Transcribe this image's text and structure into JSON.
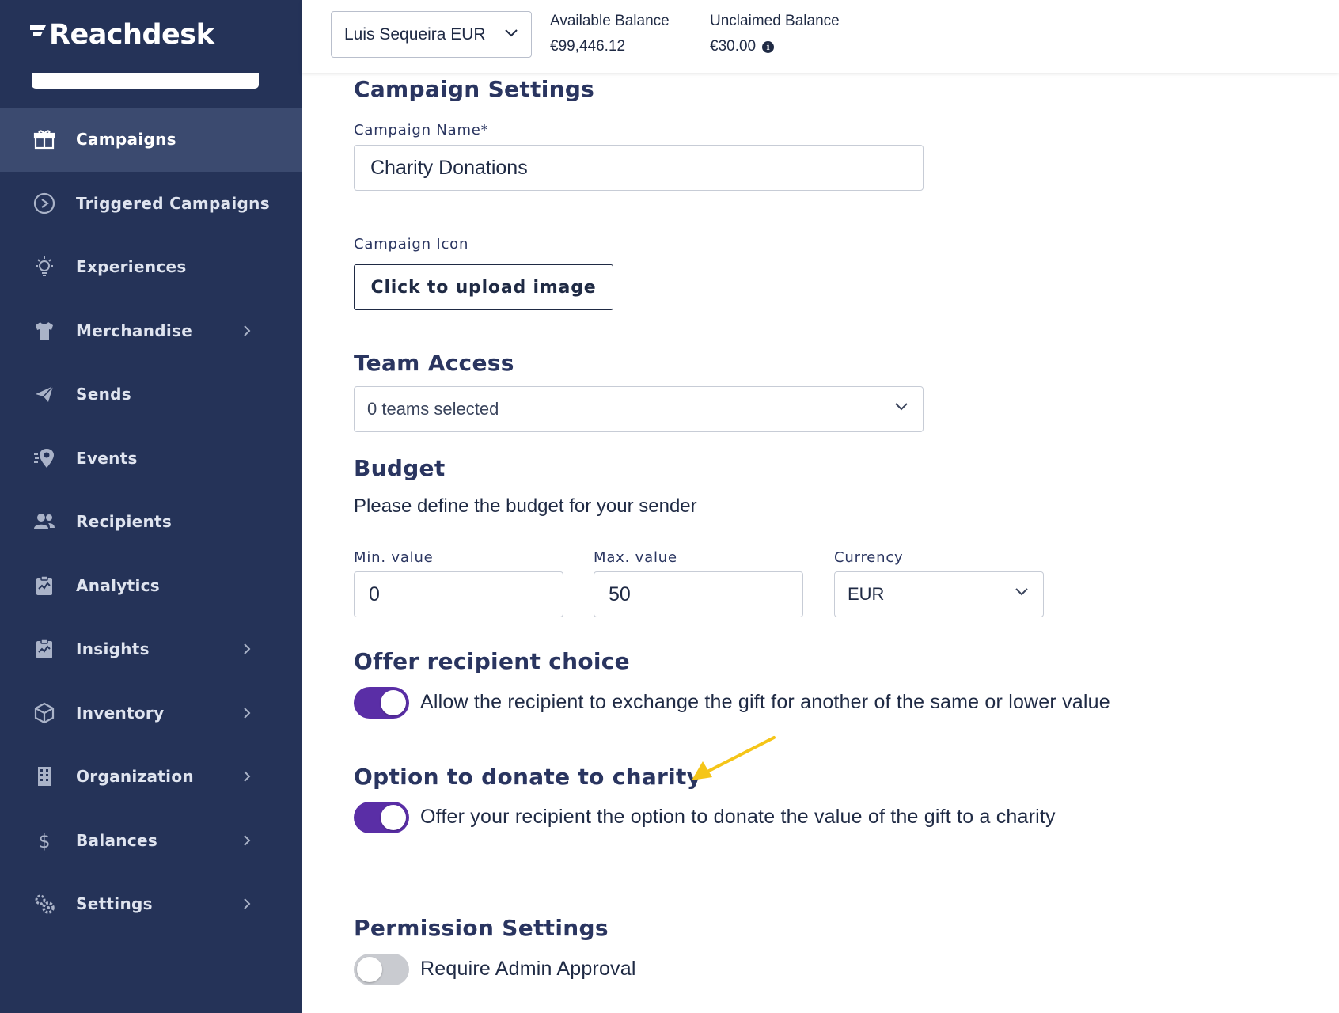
{
  "brand": {
    "name": "Reachdesk"
  },
  "colors": {
    "sidebar_bg": "#253358",
    "sidebar_active": "#3b4a6f",
    "toggle_on": "#5a2ea6",
    "toggle_off": "#c9cbd0",
    "arrow": "#f5c518"
  },
  "sidebar": {
    "items": [
      {
        "label": "Campaigns",
        "icon": "gift-icon",
        "active": true,
        "has_submenu": false
      },
      {
        "label": "Triggered Campaigns",
        "icon": "play-circle-icon",
        "active": false,
        "has_submenu": false
      },
      {
        "label": "Experiences",
        "icon": "lightbulb-icon",
        "active": false,
        "has_submenu": false
      },
      {
        "label": "Merchandise",
        "icon": "tshirt-icon",
        "active": false,
        "has_submenu": true
      },
      {
        "label": "Sends",
        "icon": "paper-plane-icon",
        "active": false,
        "has_submenu": false
      },
      {
        "label": "Events",
        "icon": "map-pin-icon",
        "active": false,
        "has_submenu": false
      },
      {
        "label": "Recipients",
        "icon": "users-icon",
        "active": false,
        "has_submenu": false
      },
      {
        "label": "Analytics",
        "icon": "clipboard-chart-icon",
        "active": false,
        "has_submenu": false
      },
      {
        "label": "Insights",
        "icon": "clipboard-chart-icon",
        "active": false,
        "has_submenu": true
      },
      {
        "label": "Inventory",
        "icon": "box-icon",
        "active": false,
        "has_submenu": true
      },
      {
        "label": "Organization",
        "icon": "building-icon",
        "active": false,
        "has_submenu": true
      },
      {
        "label": "Balances",
        "icon": "dollar-icon",
        "active": false,
        "has_submenu": true
      },
      {
        "label": "Settings",
        "icon": "gears-icon",
        "active": false,
        "has_submenu": true
      }
    ]
  },
  "topbar": {
    "account": "Luis Sequeira EUR",
    "available_label": "Available Balance",
    "available_value": "€99,446.12",
    "unclaimed_label": "Unclaimed Balance",
    "unclaimed_value": "€30.00"
  },
  "form": {
    "section_title": "Campaign Settings",
    "name_label": "Campaign Name*",
    "name_value": "Charity Donations",
    "icon_label": "Campaign Icon",
    "upload_label": "Click to upload image",
    "team_title": "Team Access",
    "team_value": "0 teams selected",
    "budget_title": "Budget",
    "budget_desc": "Please define the budget for your sender",
    "min_label": "Min. value",
    "min_value": "0",
    "max_label": "Max. value",
    "max_value": "50",
    "currency_label": "Currency",
    "currency_value": "EUR",
    "choice_title": "Offer recipient choice",
    "choice_text": "Allow the recipient to exchange the gift for another of the same or lower value",
    "choice_on": true,
    "charity_title": "Option to donate to charity",
    "charity_text": "Offer your recipient the option to donate the value of the gift to a charity",
    "charity_on": true,
    "permission_title": "Permission Settings",
    "permission_text": "Require Admin Approval",
    "permission_on": false
  }
}
